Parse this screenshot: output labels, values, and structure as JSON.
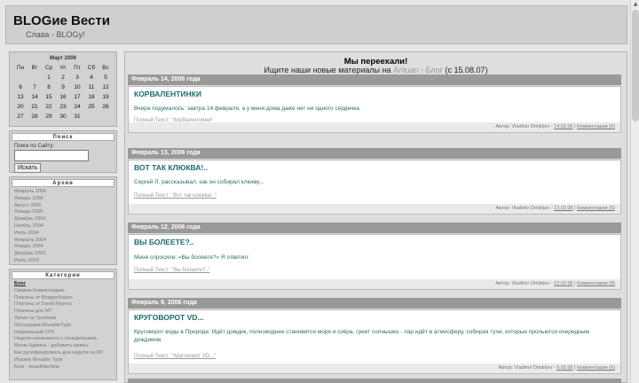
{
  "header": {
    "title": "BLOGие Вести",
    "tagline": "Слава - BLOGу!"
  },
  "calendar": {
    "caption": "Март 2006",
    "weekdays": [
      "Пн",
      "Вт",
      "Ср",
      "Чт",
      "Пт",
      "Сб",
      "Вс"
    ],
    "days": [
      [
        "",
        "",
        "1",
        "2",
        "3",
        "4",
        "5"
      ],
      [
        "6",
        "7",
        "8",
        "9",
        "10",
        "11",
        "12"
      ],
      [
        "13",
        "14",
        "15",
        "16",
        "17",
        "18",
        "19"
      ],
      [
        "20",
        "21",
        "22",
        "23",
        "24",
        "25",
        "26"
      ],
      [
        "27",
        "28",
        "29",
        "30",
        "31",
        "",
        ""
      ]
    ]
  },
  "search": {
    "title": "Поиск",
    "label": "Поиск по Сайту:",
    "input_value": "",
    "button": "Искать"
  },
  "archive": {
    "title": "Архив",
    "items": [
      "Февраль 2006",
      "Январь 2006",
      "Август 2005",
      "Январь 2005",
      "Декабрь 2004",
      "Ноябрь 2004",
      "Июль 2004",
      "Февраль 2004",
      "Январь 2004",
      "Декабрь 2003",
      "Июль 2003"
    ]
  },
  "categories": {
    "title": "Категории",
    "items": [
      "Блог",
      "Свежие Комментарии",
      "Плагины от BloggerNation",
      "Плагины от David Raynes",
      "Плагины для MT",
      "Линки на Трэкбэки",
      "Обсуждаем MovableType",
      "Нормальный УРЛ",
      "Недели начинаются с понедельника",
      "Меню Админа - добавить запись",
      "Как русифицировать дни недели на МТ",
      "Играем Movable Type",
      "Блог - boastMachine"
    ]
  },
  "announcement": {
    "heading": "Мы переехали!",
    "text_before": "Ищите наши новые материалы на ",
    "link": "Antuan - Блог",
    "text_after": " (с 15.08.07)"
  },
  "posts": [
    {
      "date": "Февраль 14, 2006 года",
      "title": "КОРВАЛЕНТИНКИ",
      "body": "Вчера подумалось: завтра 14 февраля, а у меня дома даже нет ни одного сердечка",
      "more": "Полный Текст: \"КорВалентинки\"",
      "footer_author": "Автор: Vladimir Dmitrijev",
      "footer_time": "14.02.06",
      "footer_comments": "Комментарии (6)"
    },
    {
      "date": "Февраль 13, 2006 года",
      "title": "ВОТ ТАК КЛЮКВА!..",
      "body": "Сергей Л. рассказывал, как он собирал клюкву...",
      "more": "Полный Текст: \"Вот так клюква!..\"",
      "footer_author": "Автор: Vladimir Dmitrijev",
      "footer_time": "13.02.06",
      "footer_comments": "Комментарии (6)"
    },
    {
      "date": "Февраль 12, 2006 года",
      "title": "ВЫ БОЛЕЕТЕ?..",
      "body": "Меня спросили: «Вы болеете?» Я ответил:",
      "more": "Полный Текст: \"Вы болеете?..\"",
      "footer_author": "Автор: Vladimir Dmitrijev",
      "footer_time": "12.02.06",
      "footer_comments": "Комментарии (8)"
    },
    {
      "date": "Февраль 9, 2006 года",
      "title": "КРУГОВОРОТ VD...",
      "body": "Круговорот воды в Природе: Идёт дождик, полноводнее становятся моря и озёра, греет солнышко - пар идёт в атмосферу, собирая тучи, которые прольются очередным дождиком",
      "more": "Полный Текст: \"Круговорот VD...\"",
      "footer_author": "Автор: Vladimir Dmitrijev",
      "footer_time": "9.02.06",
      "footer_comments": "Комментарии (6)"
    }
  ]
}
